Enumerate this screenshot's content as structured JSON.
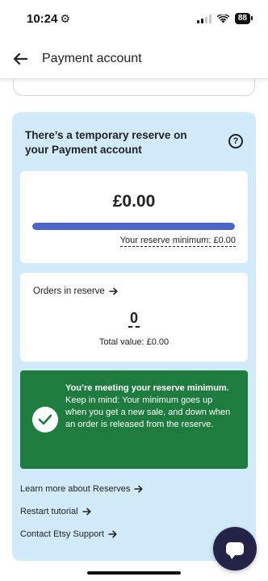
{
  "status_bar": {
    "time": "10:24",
    "battery": "88"
  },
  "header": {
    "title": "Payment account"
  },
  "reserve": {
    "title": "There’s a temporary reserve on your Payment account",
    "help": "?",
    "amount": "£0.00",
    "progress": 1.0,
    "reserve_minimum": "Your reserve minimum: £0.00",
    "orders_link": "Orders in reserve",
    "orders_count": "0",
    "orders_total": "Total value: £0.00",
    "success_bold": "You’re meeting your reserve minimum.",
    "success_text": " Keep in mind: Your minimum goes up when you get a new sale, and down when an order is released from the reserve."
  },
  "links": {
    "learn_more": "Learn more about Reserves",
    "restart_tutorial": "Restart tutorial",
    "contact_support": "Contact Etsy Support"
  },
  "colors": {
    "panel_bg": "#d1ebfb",
    "progress": "#4d64c9",
    "success": "#1e7c3f",
    "fab": "#232347"
  }
}
